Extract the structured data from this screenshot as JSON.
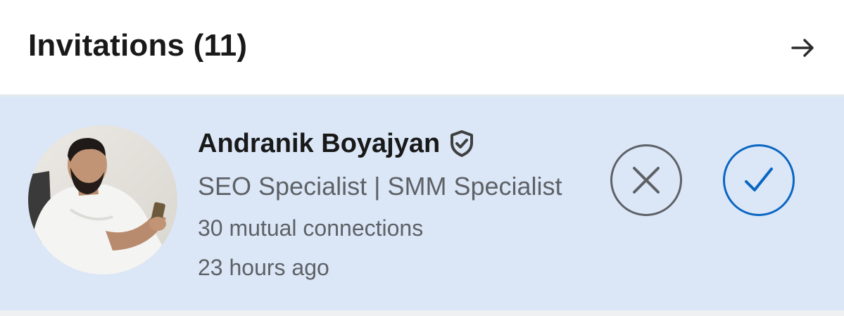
{
  "header": {
    "title": "Invitations (11)",
    "see_all_icon": "arrow-right-icon"
  },
  "invitation": {
    "name": "Andranik Boyajyan",
    "verified_icon": "verified-shield-icon",
    "headline": "SEO Specialist | SMM Specialist",
    "mutual_connections": "30 mutual connections",
    "time_ago": "23 hours ago",
    "ignore_icon": "close-icon",
    "accept_icon": "checkmark-icon"
  },
  "colors": {
    "card_background": "#dbe7f7",
    "accent": "#0a66c2",
    "secondary_text": "#5e6166",
    "primary_text": "#191919"
  }
}
